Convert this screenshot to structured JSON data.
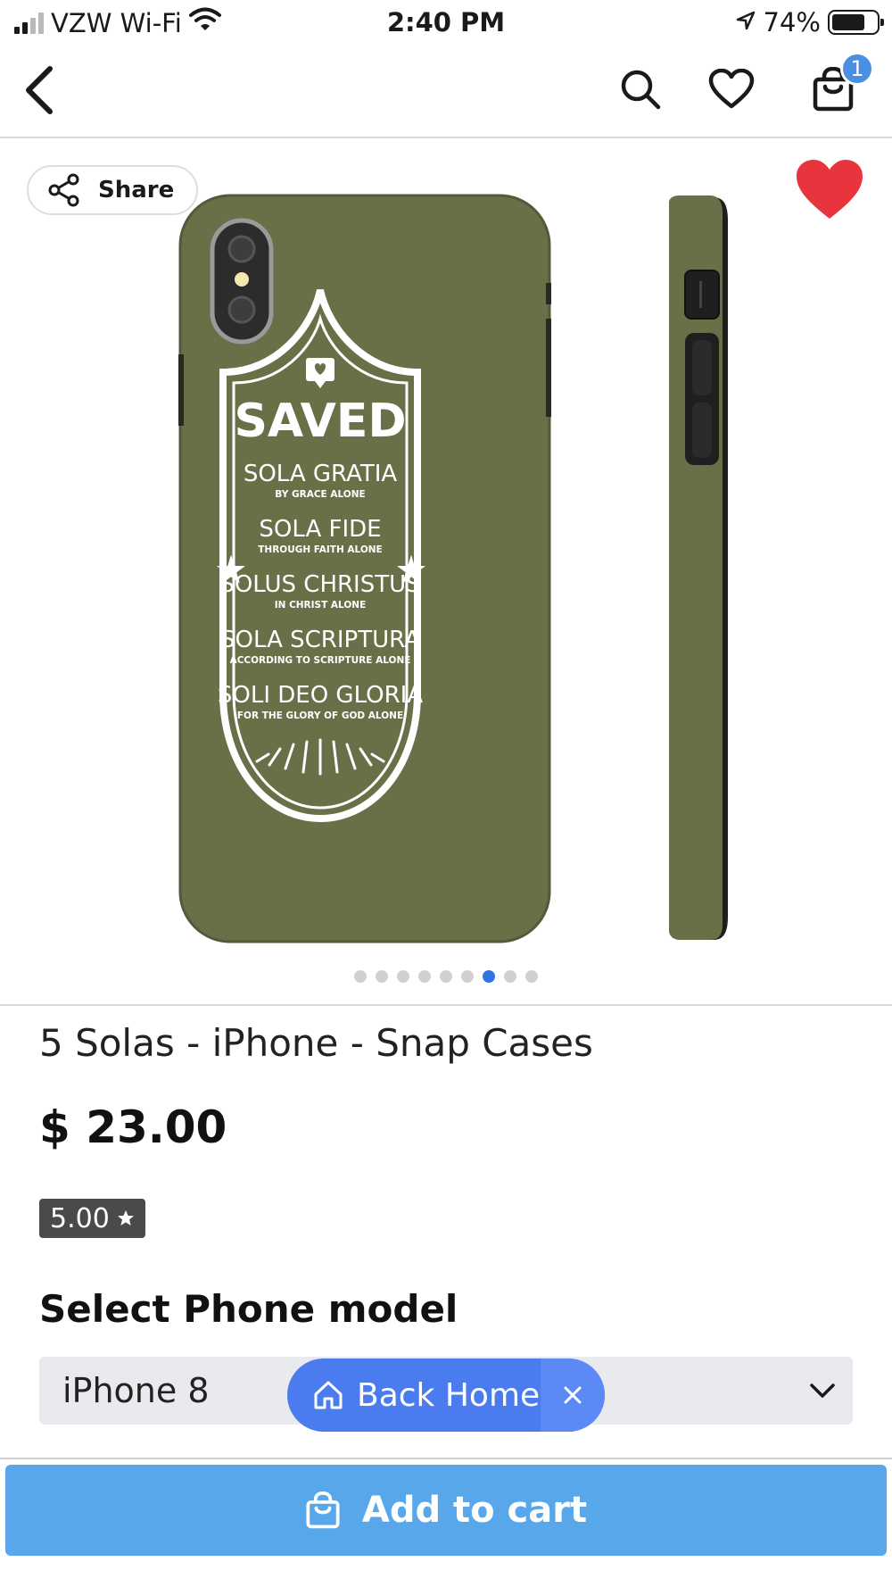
{
  "status_bar": {
    "carrier": "VZW Wi-Fi",
    "time": "2:40 PM",
    "battery": "74%",
    "battery_level": 0.74
  },
  "nav": {
    "cart_count": "1"
  },
  "gallery": {
    "share_label": "Share",
    "dot_count": 9,
    "active_dot": 6,
    "case_color": "#6b6f48",
    "case_print": {
      "title": "SAVED",
      "lines": [
        {
          "main": "SOLA GRATIA",
          "sub": "BY GRACE ALONE"
        },
        {
          "main": "SOLA FIDE",
          "sub": "THROUGH FAITH ALONE"
        },
        {
          "main": "SOLUS CHRISTUS",
          "sub": "IN CHRIST ALONE"
        },
        {
          "main": "SOLA SCRIPTURA",
          "sub": "ACCORDING TO SCRIPTURE ALONE"
        },
        {
          "main": "SOLI DEO GLORIA",
          "sub": "FOR THE GLORY OF GOD ALONE"
        }
      ]
    }
  },
  "product": {
    "title": "5 Solas - iPhone - Snap Cases",
    "price": "$ 23.00",
    "rating": "5.00"
  },
  "options": {
    "label": "Select Phone model",
    "selected": "iPhone 8"
  },
  "back_home": {
    "label": "Back Home"
  },
  "cta": {
    "label": "Add to cart"
  },
  "colors": {
    "accent": "#4a7cf0",
    "cta": "#57a7ea",
    "heart": "#e8343c",
    "badge": "#4a8fe4"
  }
}
